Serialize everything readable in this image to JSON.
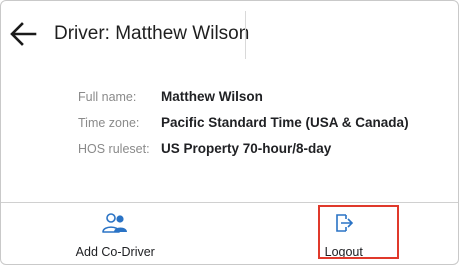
{
  "header": {
    "title": "Driver: Matthew Wilson",
    "back_icon": "arrow-left-icon"
  },
  "info": {
    "rows": [
      {
        "label": "Full name:",
        "value": "Matthew Wilson"
      },
      {
        "label": "Time zone:",
        "value": "Pacific Standard Time (USA & Canada)"
      },
      {
        "label": "HOS ruleset:",
        "value": "US Property 70-hour/8-day"
      }
    ]
  },
  "footer": {
    "add_codriver": {
      "label": "Add Co-Driver",
      "icon": "add-user-icon"
    },
    "logout": {
      "label": "Logout",
      "icon": "logout-icon"
    }
  },
  "colors": {
    "accent": "#2a73c5",
    "highlight": "#e0392b"
  }
}
